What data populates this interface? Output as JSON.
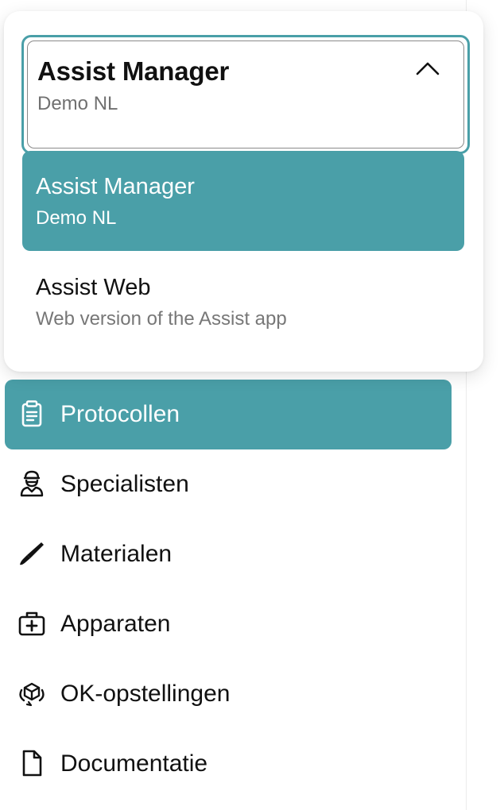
{
  "app_selector": {
    "current": {
      "title": "Assist Manager",
      "subtitle": "Demo NL"
    },
    "expanded_icon": "chevron-up-icon",
    "options": [
      {
        "title": "Assist Manager",
        "subtitle": "Demo NL",
        "selected": true
      },
      {
        "title": "Assist Web",
        "subtitle": "Web version of the Assist app",
        "selected": false
      }
    ]
  },
  "nav": {
    "items": [
      {
        "label": "Protocollen",
        "icon": "clipboard-icon",
        "active": true
      },
      {
        "label": "Specialisten",
        "icon": "surgeon-icon",
        "active": false
      },
      {
        "label": "Materialen",
        "icon": "scalpel-icon",
        "active": false
      },
      {
        "label": "Apparaten",
        "icon": "medical-kit-icon",
        "active": false
      },
      {
        "label": "OK-opstellingen",
        "icon": "cube-rotate-icon",
        "active": false
      },
      {
        "label": "Documentatie",
        "icon": "document-icon",
        "active": false
      }
    ]
  },
  "colors": {
    "accent": "#4a9fa8",
    "text": "#111111",
    "muted": "#707070"
  }
}
